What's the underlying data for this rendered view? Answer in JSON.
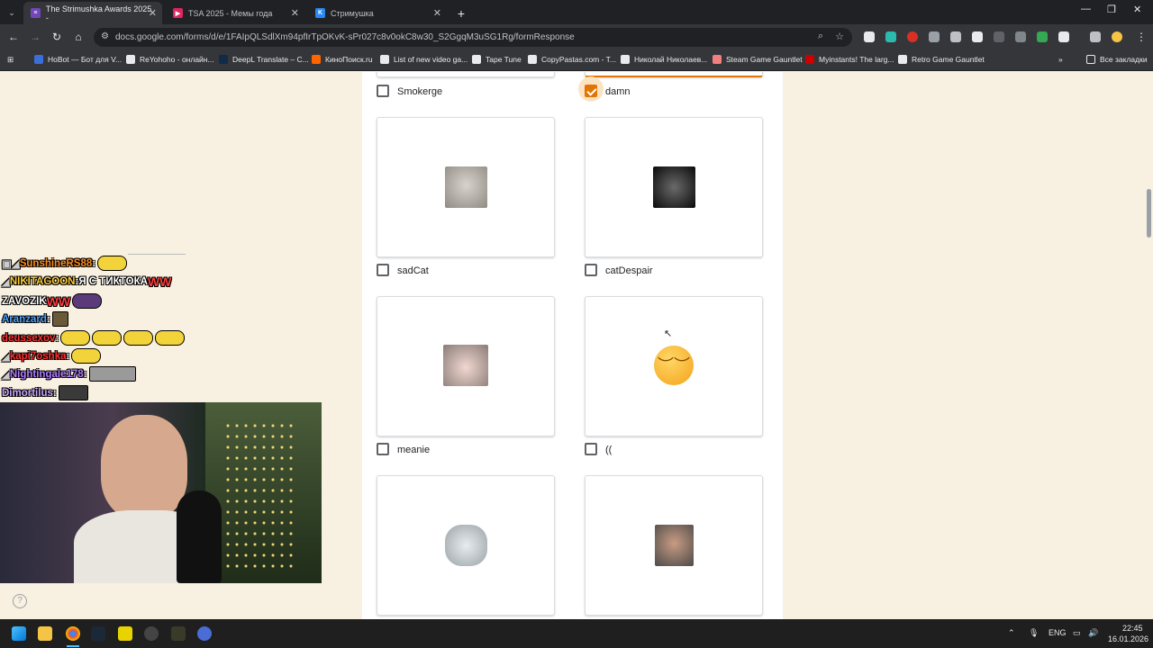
{
  "browser": {
    "tabs": [
      {
        "label": "The Strimushka Awards 2025 -",
        "favicon_color": "#7248b9"
      },
      {
        "label": "TSA 2025 - Мемы года",
        "favicon_color": "#e0245e"
      },
      {
        "label": "Стримушка",
        "favicon_color": "#2787f5"
      }
    ],
    "new_tab": "+",
    "url": "docs.google.com/forms/d/e/1FAIpQLSdlXm94pfIrTpOKvK-sPr027c8v0okC8w30_S2GgqM3uSG1Rg/formResponse",
    "bookmarks": [
      {
        "label": "HoBot — Бот для V...",
        "color": "#3b6fd8"
      },
      {
        "label": "ReYohoho - онлайн...",
        "color": "#e8eaed"
      },
      {
        "label": "DeepL Translate – С...",
        "color": "#0f2b46"
      },
      {
        "label": "КиноПоиск.ru",
        "color": "#f60"
      },
      {
        "label": "List of new video ga...",
        "color": "#e8eaed"
      },
      {
        "label": "Tape Tune",
        "color": "#e8eaed"
      },
      {
        "label": "CopyPastas.com - T...",
        "color": "#e8eaed"
      },
      {
        "label": "Николай Николаев...",
        "color": "#e8eaed"
      },
      {
        "label": "Steam Game Gauntlet",
        "color": "#f08080"
      },
      {
        "label": "Myinstants! The larg...",
        "color": "#c00"
      },
      {
        "label": "Retro Game Gauntlet",
        "color": "#e8eaed"
      }
    ],
    "bookmarks_folder": "Все закладки"
  },
  "form": {
    "options": [
      {
        "label": "Smokerge",
        "checked": false
      },
      {
        "label": "damn",
        "checked": true
      },
      {
        "label": "sadCat",
        "checked": false,
        "thumb": "#b9b3aa"
      },
      {
        "label": "catDespair",
        "checked": false,
        "thumb": "#1b1b1b"
      },
      {
        "label": "meanie",
        "checked": false,
        "thumb": "#d9c7c1"
      },
      {
        "label": "((",
        "checked": false,
        "emoji": "😔"
      },
      {
        "label": "",
        "checked": false,
        "thumb": "#cfd2d4"
      },
      {
        "label": "",
        "checked": false,
        "thumb": "#8d8a86"
      }
    ]
  },
  "chat": [
    {
      "user": "SunshineRS88",
      "user_color": "#ff8c1a",
      "sep": " :",
      "text": "",
      "emotes": 1
    },
    {
      "user": "NIKITAGOON",
      "user_color": "#ffcc33",
      "sep": " :",
      "text": " Я С ТИКТОКА ",
      "suffix": "WW",
      "suffix_color": "#ff3b3b",
      "emotes": 0
    },
    {
      "user": "ZAVOZIK",
      "user_color": "#ffffff",
      "sep": "",
      "text": " ",
      "suffix": "WW",
      "suffix_color": "#ff3b3b",
      "emotes": 1
    },
    {
      "user": "Aranzard",
      "user_color": "#4aa3ff",
      "sep": " :",
      "text": "",
      "emotes": 1
    },
    {
      "user": "deussexov",
      "user_color": "#ff3030",
      "sep": " :",
      "text": "",
      "emotes": 4
    },
    {
      "user": "kapi7oshka",
      "user_color": "#ff3030",
      "sep": " :",
      "text": "",
      "emotes": 1
    },
    {
      "user": "Nightingale178",
      "user_color": "#b07cff",
      "sep": " :",
      "text": "",
      "emotes": 2
    },
    {
      "user": "Dimortilus",
      "user_color": "#c9a7ff",
      "sep": " :",
      "text": "",
      "emotes": 1
    }
  ],
  "taskbar": {
    "lang": "ENG",
    "time": "22:45",
    "date": "16.01.2026"
  }
}
